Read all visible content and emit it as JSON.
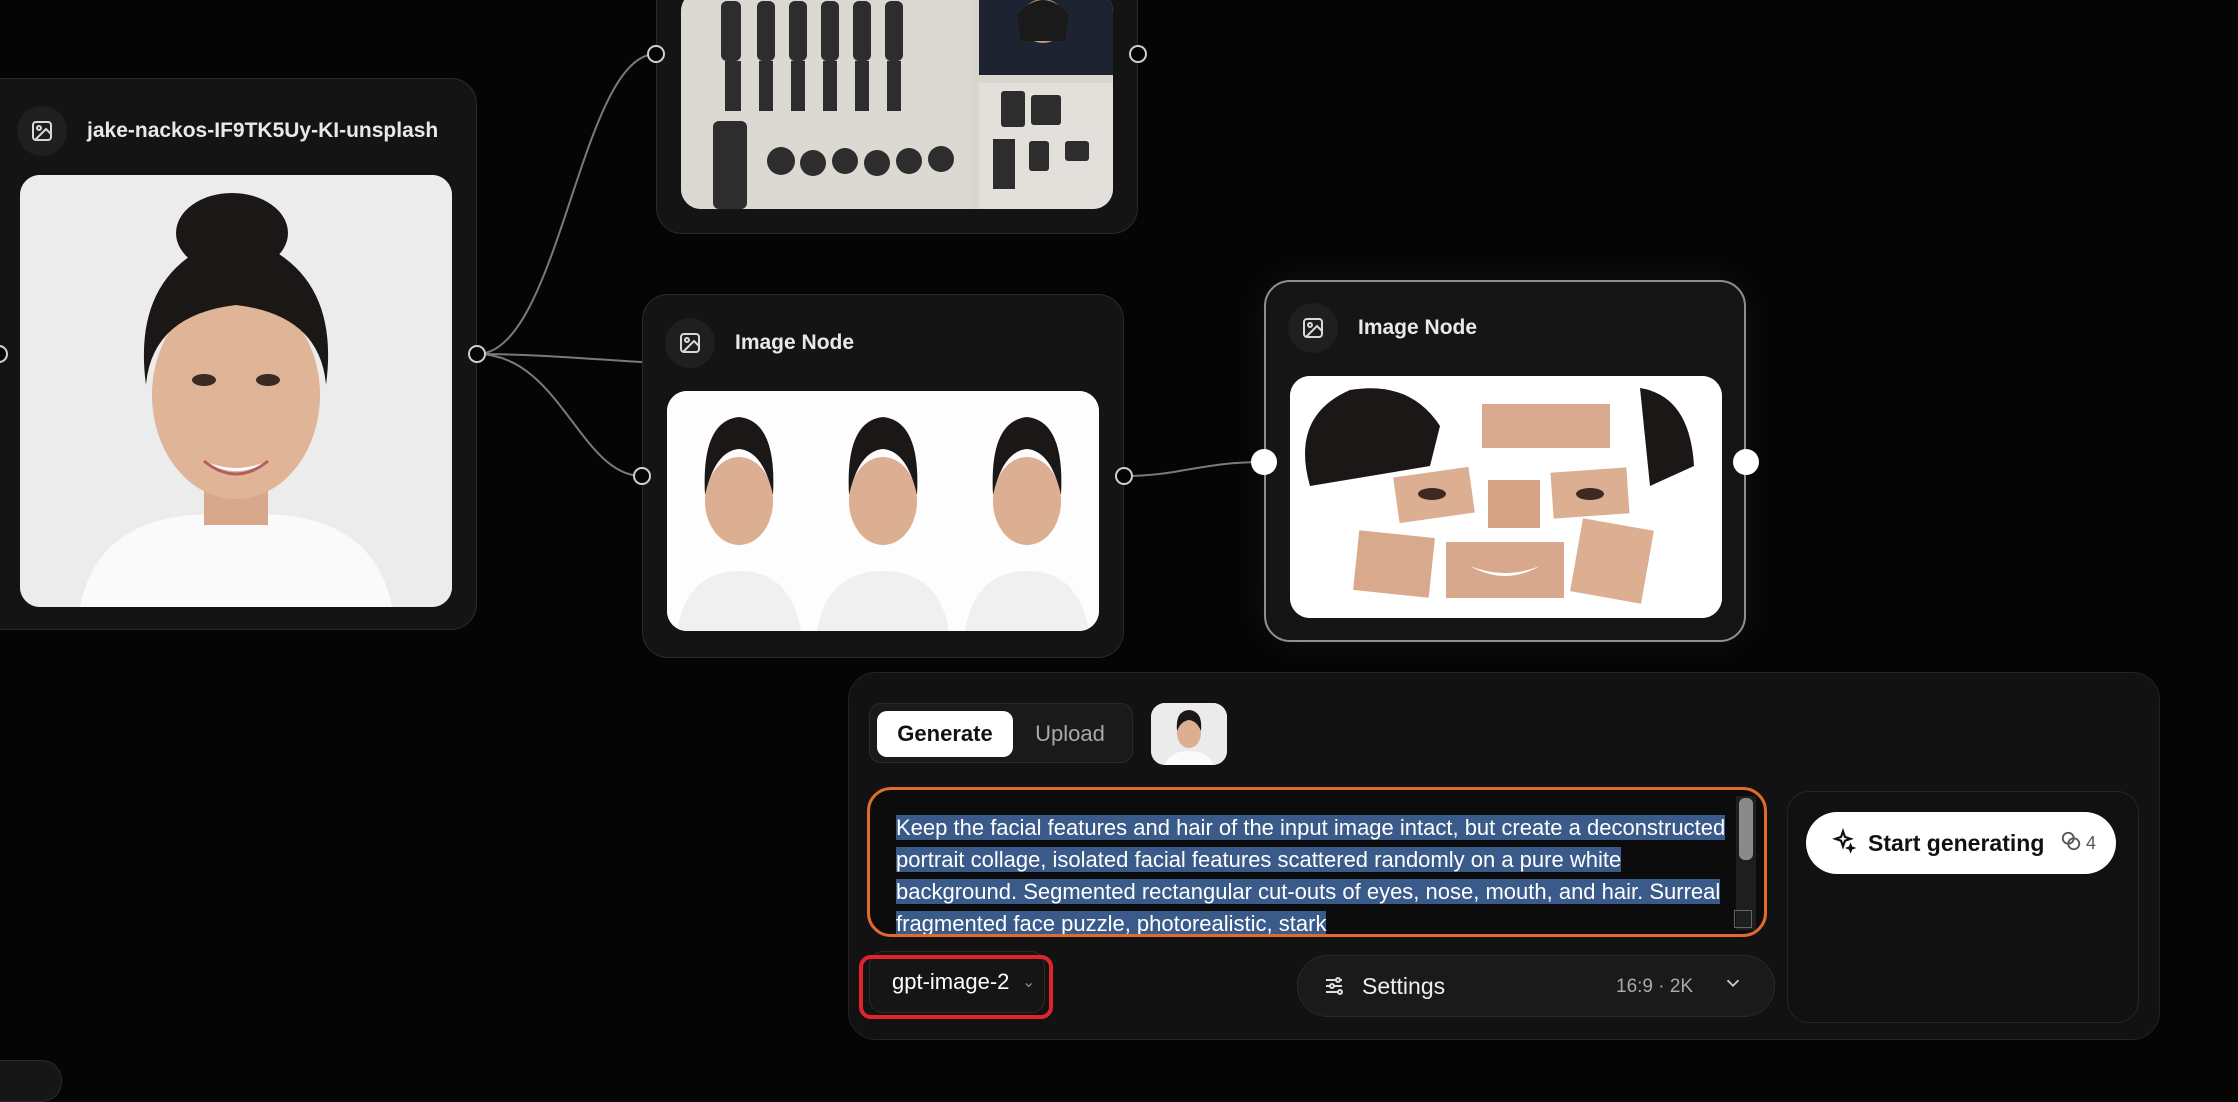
{
  "canvas": {
    "nodes": [
      {
        "id": "source",
        "title": "jake-nackos-IF9TK5Uy-KI-unsplash",
        "icon": "image-icon"
      },
      {
        "id": "turnaround",
        "title": "",
        "icon": "image-icon"
      },
      {
        "id": "three-views",
        "title": "Image Node",
        "icon": "image-icon"
      },
      {
        "id": "collage",
        "title": "Image Node",
        "icon": "image-icon"
      }
    ]
  },
  "panel": {
    "tabs": [
      {
        "label": "Generate",
        "active": true
      },
      {
        "label": "Upload",
        "active": false
      }
    ],
    "prompt": {
      "value": "Keep the facial features and hair of the input image intact, but create a deconstructed portrait collage, isolated facial features scattered randomly on a pure white background. Segmented rectangular cut-outs of eyes, nose, mouth, and hair. Surreal fragmented face puzzle, photorealistic, stark"
    },
    "start_button": {
      "label": "Start generating",
      "credits": "4"
    },
    "model": {
      "value": "gpt-image-2"
    },
    "settings": {
      "label": "Settings",
      "value": "16:9 · 2K"
    }
  },
  "colors": {
    "prompt_border": "#e26a2c",
    "highlight_box": "#e0242c",
    "selection": "#3a5a8a"
  }
}
